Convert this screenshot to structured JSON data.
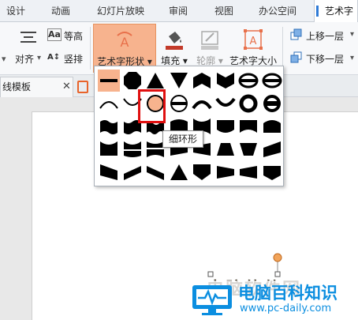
{
  "tabs": [
    "设计",
    "动画",
    "幻灯片放映",
    "审阅",
    "视图",
    "办公空间",
    "艺术字"
  ],
  "ribbon": {
    "align_btn": "对齐",
    "equal_height": "等高",
    "vertical_text": "竖排",
    "shape_btn": "艺术字形状",
    "fill_btn": "填充",
    "outline_btn": "轮廓",
    "size_btn": "艺术字大小",
    "bring_forward": "上移一层",
    "send_backward": "下移一层"
  },
  "doc_tab": "线模板",
  "tooltip": "细环形",
  "wordart_text": "电脑软件网",
  "watermark": {
    "title": "电脑百科知识",
    "url": "www.pc-daily.com"
  },
  "colors": {
    "accent": "#2f7bd6",
    "active_button": "#f7b38e",
    "highlight": "#e01010",
    "watermark": "#0b8ee0",
    "handle": "#f2a45a"
  },
  "shape_grid": {
    "rows": 5,
    "cols": 8,
    "selected": "thin-ring",
    "shapes": [
      [
        "plain-text",
        "octagon",
        "triangle-up",
        "triangle-down",
        "chevron-up",
        "chevron-down",
        "ring-arrow-up",
        "ring-arrow-down"
      ],
      [
        "arch-up",
        "arch-down",
        "thin-ring",
        "button",
        "arch-up-thin",
        "arch-down-thin",
        "thick-ring",
        "thick-button"
      ],
      [
        "wave1",
        "wave2",
        "double-wave",
        "inflate",
        "deflate",
        "inflate-bottom",
        "deflate-bottom",
        "inflate-top"
      ],
      [
        "deflate-top",
        "deflate-inflate",
        "deflate-inflate-deflate",
        "fade-right",
        "fade-left",
        "fade-up",
        "fade-down",
        "slant-up"
      ],
      [
        "slant-down",
        "cascade-up",
        "cascade-down",
        "triangle-bottom",
        "chevron-bottom",
        "wave-left",
        "wave-right",
        "curve-down"
      ]
    ]
  }
}
